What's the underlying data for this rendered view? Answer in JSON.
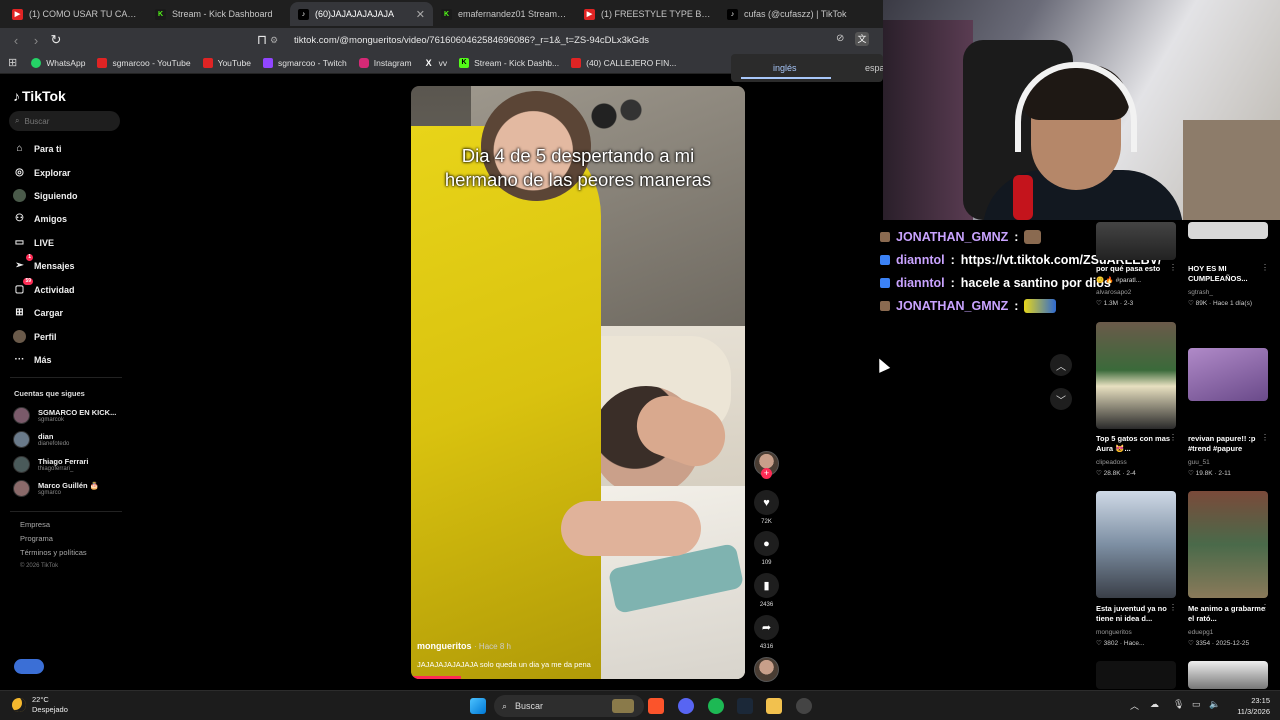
{
  "browser": {
    "tabs": [
      {
        "label": "(1) COMO USAR TU CAMARA",
        "favicon": "youtube-icon",
        "active": false
      },
      {
        "label": "Stream - Kick Dashboard",
        "favicon": "kick-icon",
        "active": false
      },
      {
        "label": "(60)JAJAJAJAJAJA",
        "favicon": "tiktok-icon",
        "active": true
      },
      {
        "label": "emafernandez01 Stream - Wat",
        "favicon": "kick-icon",
        "active": false
      },
      {
        "label": "(1) FREESTYLE TYPE BEAT - \"K",
        "favicon": "youtube-icon",
        "active": false
      },
      {
        "label": "cufas (@cufaszz) | TikTok",
        "favicon": "tiktok-icon",
        "active": false
      }
    ],
    "url": "tiktok.com/@mongueritos/video/7616060462584696086?_r=1&_t=ZS-94cDLx3kGds",
    "bookmarks": [
      {
        "label": "WhatsApp",
        "icon": "whatsapp-icon",
        "color": "#25d366"
      },
      {
        "label": "sgmarcoo - YouTube",
        "icon": "youtube-icon",
        "color": "#e02424"
      },
      {
        "label": "YouTube",
        "icon": "youtube-icon",
        "color": "#e02424"
      },
      {
        "label": "sgmarcoo - Twitch",
        "icon": "twitch-icon",
        "color": "#9146ff"
      },
      {
        "label": "Instagram",
        "icon": "instagram-icon",
        "color": "#d62976"
      },
      {
        "label": "vv",
        "icon": "x-icon",
        "color": "#000000"
      },
      {
        "label": "Stream - Kick Dashb...",
        "icon": "kick-icon",
        "color": "#53fc18"
      },
      {
        "label": "(40) CALLEJERO FIN...",
        "icon": "youtube-icon",
        "color": "#e02424"
      }
    ],
    "translate": {
      "from": "inglés",
      "to": "espa"
    }
  },
  "tiktok": {
    "logo": "TikTok",
    "search_placeholder": "Buscar",
    "nav": [
      {
        "label": "Para ti",
        "icon": "home-icon"
      },
      {
        "label": "Explorar",
        "icon": "compass-icon"
      },
      {
        "label": "Siguiendo",
        "icon": "following-icon"
      },
      {
        "label": "Amigos",
        "icon": "friends-icon"
      },
      {
        "label": "LIVE",
        "icon": "live-icon"
      },
      {
        "label": "Mensajes",
        "icon": "messages-icon",
        "badge": "1"
      },
      {
        "label": "Actividad",
        "icon": "activity-icon",
        "badge": "59"
      },
      {
        "label": "Cargar",
        "icon": "upload-icon"
      },
      {
        "label": "Perfil",
        "icon": "profile-icon"
      },
      {
        "label": "Más",
        "icon": "more-icon"
      }
    ],
    "following_header": "Cuentas que sigues",
    "following": [
      {
        "name": "SGMARCO EN KICK...",
        "user": "sgmarcok"
      },
      {
        "name": "dian",
        "user": "dianefotedo"
      },
      {
        "name": "Thiago Ferrari",
        "user": "thiagoferrari_"
      },
      {
        "name": "Marco Guillén 🎂",
        "user": "sgmarco"
      }
    ],
    "footer": [
      "Empresa",
      "Programa",
      "Términos y políticas"
    ],
    "copyright": "© 2026 TikTok"
  },
  "video": {
    "caption": "Dia 4 de 5 despertando a mi hermano de las peores maneras",
    "author": "mongueritos",
    "time": "· Hace 8 h",
    "description": "JAJAJAJAJAJAJA solo queda un dia ya me da pena",
    "likes": "72K",
    "comments": "109",
    "saves": "2436",
    "shares": "4316"
  },
  "chat": [
    {
      "user": "JONATHAN_GMNZ",
      "text": "",
      "emote": "face",
      "icon_color": "#8a6a50"
    },
    {
      "user": "dianntol",
      "text": "https://vt.tiktok.com/ZSuARLEBV/",
      "icon_color": "#3b82f6"
    },
    {
      "user": "dianntol",
      "text": "hacele a santino por dios",
      "icon_color": "#3b82f6"
    },
    {
      "user": "JONATHAN_GMNZ",
      "text": "",
      "emote": "flag",
      "icon_color": "#8a6a50"
    }
  ],
  "related": [
    {
      "title": "por qué pasa esto",
      "tags": "🙂 🔥 #paratl...",
      "user": "alvarosapo2",
      "stats": "♡ 1.3M · 2-3"
    },
    {
      "title": "HOY ES MI CUMPLEAÑOS...",
      "tags": "",
      "user": "sgtrash_",
      "stats": "♡ 89K · Hace 1 día(s)"
    },
    {
      "title": "Top 5 gatos con mas Aura 😻...",
      "tags": "",
      "user": "clipeadoss",
      "stats": "♡ 28.8K · 2-4"
    },
    {
      "title": "revivan papure!! :p #trend #papure",
      "tags": "",
      "user": "guu_51",
      "stats": "♡ 19.8K · 2-11"
    },
    {
      "title": "Esta juventud ya no tiene ni idea d...",
      "tags": "",
      "user": "mongueritos",
      "stats": "♡ 3802 · Hace..."
    },
    {
      "title": "Me animo a grabarme el rató...",
      "tags": "",
      "user": "eduepg1",
      "stats": "♡ 3354 · 2025-12-25"
    }
  ],
  "taskbar": {
    "temp": "22°C",
    "weather": "Despejado",
    "search": "Buscar",
    "time": "23:15",
    "date": "11/3/2026"
  }
}
